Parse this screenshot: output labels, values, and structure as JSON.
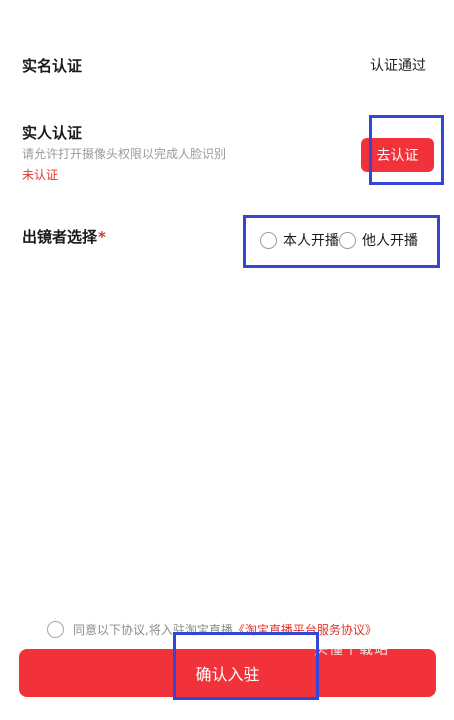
{
  "realname": {
    "label": "实名认证",
    "status": "认证通过"
  },
  "face": {
    "title": "实人认证",
    "description": "请允许打开摄像头权限以完成人脸识别",
    "status": "未认证",
    "button_label": "去认证"
  },
  "anchor": {
    "label": "出镜者选择",
    "required_mark": "*",
    "options": [
      {
        "label": "本人开播",
        "selected": false
      },
      {
        "label": "他人开播",
        "selected": false
      }
    ]
  },
  "agreement": {
    "prefix": "同意以下协议,将入驻淘宝直播",
    "link": "《淘宝直播平台服务协议》",
    "checked": false
  },
  "confirm_button": {
    "label": "确认入驻"
  },
  "watermark": "头懂个载站",
  "colors": {
    "accent": "#f2323a",
    "highlight_box": "#3446d6",
    "muted": "#9a9a9a"
  }
}
